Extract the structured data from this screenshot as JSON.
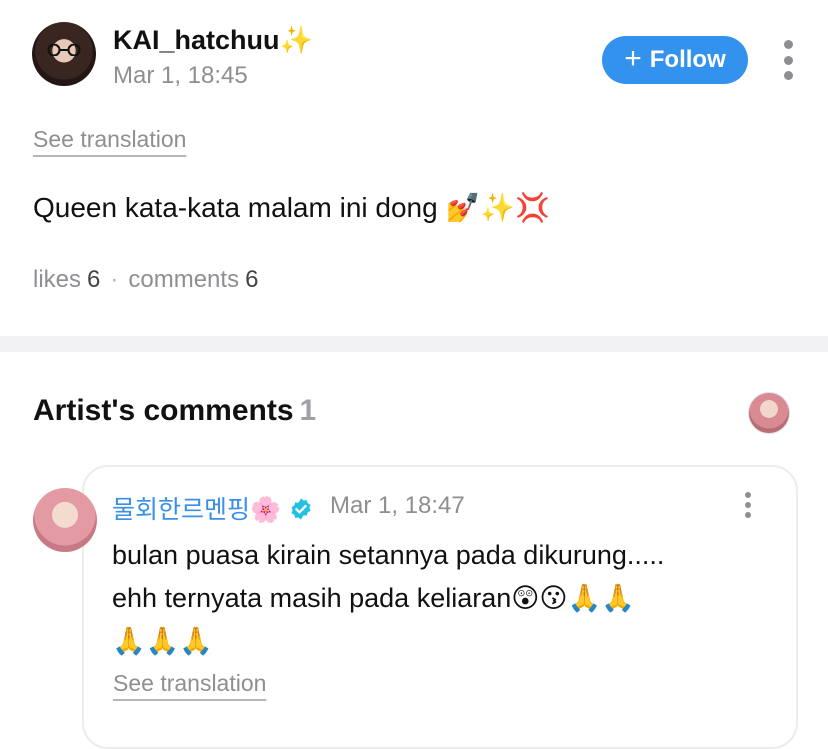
{
  "post": {
    "username": "KAI_hatchuu✨",
    "time": "Mar 1, 18:45",
    "follow_label": "Follow",
    "see_translation": "See translation",
    "body": "Queen kata-kata malam ini dong 💅✨💢",
    "likes_label": "likes",
    "likes_count": "6",
    "comments_label": "comments",
    "comments_count": "6"
  },
  "artist_comments": {
    "title": "Artist's comments",
    "count": "1",
    "comment": {
      "author": "물회한르멘핑🌸",
      "time": "Mar 1, 18:47",
      "lines": [
        "bulan puasa kirain setannya pada dikurung.....",
        "ehh ternyata masih pada keliaran😲😗🙏🙏",
        "🙏🙏🙏"
      ],
      "see_translation": "See translation"
    }
  },
  "colors": {
    "accent": "#3492ef",
    "artist_name": "#3a8fe9",
    "muted": "#8e8e93",
    "divider": "#f2f2f4"
  },
  "icons": [
    "plus-icon",
    "more-vertical-icon",
    "verified-badge-icon"
  ]
}
